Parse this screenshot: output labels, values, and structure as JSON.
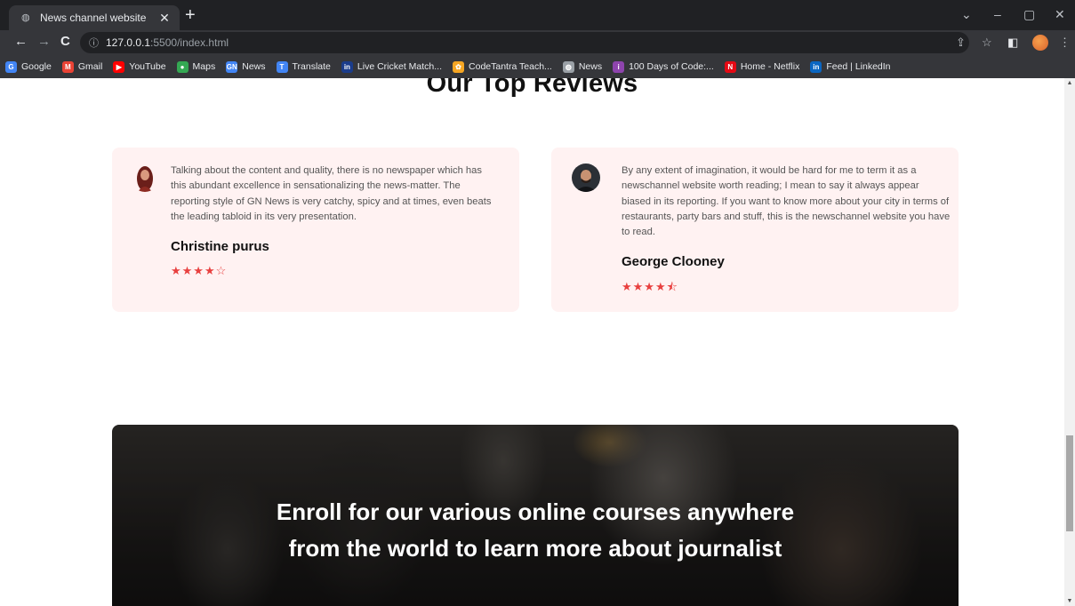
{
  "browser": {
    "tab_title": "News channel website",
    "url_host": "127.0.0.1",
    "url_path": ":5500/index.html",
    "bookmarks": [
      {
        "label": "Google",
        "icon": "google-icon",
        "color": "#4285f4"
      },
      {
        "label": "Gmail",
        "icon": "gmail-icon",
        "color": "#ea4335"
      },
      {
        "label": "YouTube",
        "icon": "youtube-icon",
        "color": "#ff0000"
      },
      {
        "label": "Maps",
        "icon": "maps-icon",
        "color": "#34a853"
      },
      {
        "label": "News",
        "icon": "google-news-icon",
        "color": "#4285f4"
      },
      {
        "label": "Translate",
        "icon": "translate-icon",
        "color": "#4285f4"
      },
      {
        "label": "Live Cricket Match...",
        "icon": "cricket-icon",
        "color": "#1a3c8b"
      },
      {
        "label": "CodeTantra Teach...",
        "icon": "codetantra-icon",
        "color": "#f5a623"
      },
      {
        "label": "News",
        "icon": "globe-icon",
        "color": "#9aa0a6"
      },
      {
        "label": "100 Days of Code:...",
        "icon": "codedays-icon",
        "color": "#8e44ad"
      },
      {
        "label": "Home - Netflix",
        "icon": "netflix-icon",
        "color": "#e50914"
      },
      {
        "label": "Feed | LinkedIn",
        "icon": "linkedin-icon",
        "color": "#0a66c2"
      }
    ]
  },
  "reviews_section": {
    "title": "Our Top Reviews",
    "reviews": [
      {
        "text": "Talking about the content and quality, there is no newspaper which has this abundant excellence in sensationalizing the news-matter. The reporting style of GN News is very catchy, spicy and at times, even beats the leading tabloid in its very presentation.",
        "name": "Christine purus",
        "stars": "★★★★☆"
      },
      {
        "text": "By any extent of imagination, it would be hard for me to term it as a newschannel website worth reading; I mean to say it always appear biased in its reporting. If you want to know more about your city in terms of restaurants, party bars and stuff, this is the newschannel website you have to read.",
        "name": "George Clooney",
        "stars": "★★★★⯪"
      }
    ]
  },
  "banner": {
    "text": "Enroll for our various online courses anywhere from the world to learn more about journalist"
  }
}
